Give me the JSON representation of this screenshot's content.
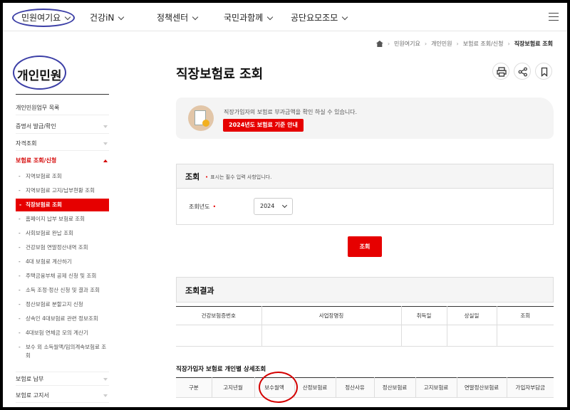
{
  "nav": {
    "items": [
      "민원여기요",
      "건강iN",
      "정책센터",
      "국민과함께",
      "공단요모조모"
    ]
  },
  "breadcrumb": [
    "민원여기요",
    "개인민원",
    "보험료 조회/신청",
    "직장보험료 조회"
  ],
  "sidebar": {
    "title": "개인민원",
    "items_top": [
      "개인민원업무 목록",
      "증명서 발급/확인",
      "자격조회"
    ],
    "open_item": "보험료 조회/신청",
    "subitems": [
      "지역보험료 조회",
      "지역보험료 고지/납부현황 조회",
      "직장보험료 조회",
      "홈페이지 납부 보험료 조회",
      "사회보험료 완납 조회",
      "건강보험 연말정산내역 조회",
      "4대 보험료 계산하기",
      "주택금융부채 공제 신청 및 조회",
      "소득 조정·정산 신청 및 결과 조회",
      "정산보험료 분할고지 신청",
      "상속인 4대보험료 관련 정보조회",
      "4대보험 연체금 모의 계산기",
      "보수 외 소득월액/임의계속보험료 조회"
    ],
    "active_subitem_index": 2,
    "items_bottom": [
      "보험료 납부",
      "보험료 고지서"
    ]
  },
  "main": {
    "title": "직장보험료 조회",
    "icons": [
      "print-icon",
      "share-icon",
      "bookmark-icon"
    ],
    "info_text": "직장가입자의 보험료 부과금액을 확인 하실 수 있습니다.",
    "info_button": "2024년도 보험료 기준 안내",
    "search": {
      "heading": "조회",
      "note": "표시는 필수 입력 사항입니다.",
      "field_label": "조회년도",
      "year_value": "2024",
      "button": "조회"
    },
    "result": {
      "heading": "조회결과",
      "columns": [
        "건강보험증번호",
        "사업장명칭",
        "취득일",
        "상실일",
        "조회"
      ]
    },
    "detail": {
      "title": "직장가입자 보험료 개인별 상세조회",
      "columns": [
        "구분",
        "고지년월",
        "보수월액",
        "산정보험료",
        "정산사유",
        "정산보험료",
        "고지보험료",
        "연말정산보험료",
        "가입자부담금"
      ]
    }
  },
  "colors": {
    "accent": "#e60000",
    "annotation_blue": "#3b3ea6",
    "annotation_red": "#d40000"
  }
}
